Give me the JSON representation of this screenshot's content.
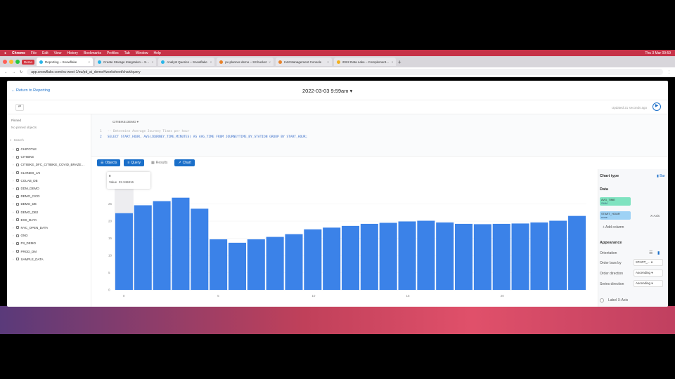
{
  "menubar": {
    "apple": "",
    "items": [
      "Chrome",
      "File",
      "Edit",
      "View",
      "History",
      "Bookmarks",
      "Profiles",
      "Tab",
      "Window",
      "Help"
    ],
    "clock": "Thu 3 Mar 09:59"
  },
  "tabs": [
    {
      "label": "Reporting – Snowflake",
      "active": true
    },
    {
      "label": "Create Storage Integration – S…",
      "active": false
    },
    {
      "label": "Analyst Queries – Snowflake",
      "active": false
    },
    {
      "label": "pv-planner-demo – S3 bucket",
      "active": false
    },
    {
      "label": "IAM Management Console",
      "active": false
    },
    {
      "label": "2022 Data Lake – Complement…",
      "active": false
    }
  ],
  "demo_badge": "Demo",
  "url": "app.snowflake.com/eu-west-1/eu/pd_ai_demo#/worksheet/chart/query",
  "app": {
    "back_label": "Return to Reporting",
    "title": "2022-03-03 9:59am",
    "updated": "Updated 21 seconds ago"
  },
  "sidebar": {
    "pinned_label": "Pinned",
    "no_pinned": "No pinned objects",
    "search_placeholder": "Search",
    "databases": [
      "CHIPOTLE",
      "CITIBIKE",
      "CITIBIKE_DFC_CITIBIKE_COVID_BRAZE…",
      "CLONED_JAI",
      "COLAB_DB",
      "DDM_DEMO",
      "DEMO_CICD",
      "DEMO_DB",
      "DEMO_DB2",
      "EXS_DATA",
      "NYC_OPEN_DATA",
      "OND",
      "PII_DEMO",
      "PROD_DM",
      "SAMPLE_DATA"
    ]
  },
  "editor": {
    "context": "CITIBIKE.DEMO",
    "line1": "-- Determine Average Journey Times per hour",
    "line2": "SELECT START_HOUR, AVG(JOURNEY_TIME_MINUTES) AS AVG_TIME FROM JOURNEYTIME_BY_STATION GROUP BY START_HOUR;"
  },
  "resbar": {
    "objects": "Objects",
    "query": "Query",
    "results": "Results",
    "chart": "Chart"
  },
  "tooltip": {
    "label": "0",
    "value_label": "Value",
    "value": "22.346816"
  },
  "chart_data": {
    "type": "bar",
    "categories": [
      0,
      1,
      2,
      3,
      4,
      5,
      6,
      7,
      8,
      9,
      10,
      11,
      12,
      13,
      14,
      15,
      16,
      17,
      18,
      19,
      20,
      21,
      22,
      23
    ],
    "values": [
      22.3,
      24.6,
      25.8,
      26.8,
      23.6,
      14.7,
      13.7,
      14.7,
      15.4,
      16.2,
      17.6,
      18.1,
      18.6,
      19.2,
      19.5,
      19.9,
      20.1,
      19.6,
      19.2,
      19.1,
      19.2,
      19.3,
      19.6,
      20.1,
      21.5
    ],
    "xticks": [
      0,
      5,
      10,
      15,
      20
    ],
    "yticks": [
      0,
      5,
      10,
      15,
      20,
      25
    ],
    "ylim": [
      0,
      30
    ],
    "highlight_index": 0,
    "bar_color": "#3b82e8"
  },
  "panel": {
    "chart_type_label": "Chart type",
    "chart_type_value": "Bar",
    "data_label": "Data",
    "y_chip": "AVG_TIME",
    "y_chip_sub": "SUM",
    "x_chip": "START_HOUR",
    "x_chip_sub": "none",
    "x_axis_label": "X-Axis",
    "add_column": "+ Add column",
    "appearance": "Appearance",
    "orientation": "Orientation",
    "order_bars_by": "Order bars by",
    "order_bars_by_value": "START_...",
    "order_direction": "Order direction",
    "order_direction_value": "Ascending",
    "series_direction": "Series direction",
    "series_direction_value": "Ascending",
    "label_x_axis": "Label X-Axis"
  }
}
